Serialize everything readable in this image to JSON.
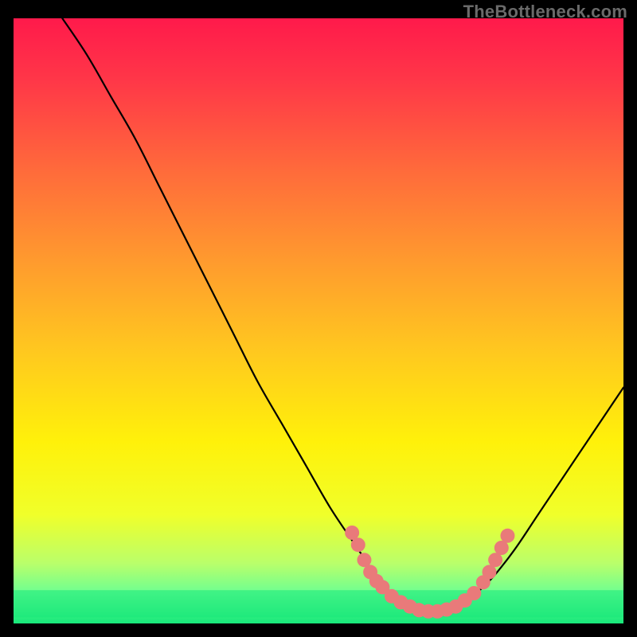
{
  "watermark": "TheBottleneck.com",
  "chart_data": {
    "type": "line",
    "title": "",
    "xlabel": "",
    "ylabel": "",
    "xlim": [
      0,
      100
    ],
    "ylim": [
      0,
      100
    ],
    "grid": false,
    "background_gradient": {
      "stops": [
        {
          "offset": 0.0,
          "color": "#ff1a4b"
        },
        {
          "offset": 0.1,
          "color": "#ff3648"
        },
        {
          "offset": 0.25,
          "color": "#ff6a3b"
        },
        {
          "offset": 0.4,
          "color": "#ff9a2e"
        },
        {
          "offset": 0.55,
          "color": "#ffc81f"
        },
        {
          "offset": 0.7,
          "color": "#fff10a"
        },
        {
          "offset": 0.82,
          "color": "#f0ff2a"
        },
        {
          "offset": 0.9,
          "color": "#baff6a"
        },
        {
          "offset": 0.95,
          "color": "#6dff92"
        },
        {
          "offset": 1.0,
          "color": "#17e87a"
        }
      ]
    },
    "series": [
      {
        "name": "curve",
        "color": "#000000",
        "x": [
          8,
          12,
          16,
          20,
          24,
          28,
          32,
          36,
          40,
          44,
          48,
          52,
          56,
          58,
          60,
          62,
          64,
          66,
          68,
          70,
          72,
          74,
          78,
          82,
          86,
          90,
          94,
          98,
          100
        ],
        "y": [
          100,
          94,
          87,
          80,
          72,
          64,
          56,
          48,
          40,
          33,
          26,
          19,
          13,
          10,
          7,
          5,
          3.5,
          2.5,
          2,
          2,
          2.5,
          3.5,
          7,
          12,
          18,
          24,
          30,
          36,
          39
        ]
      }
    ],
    "highlight_scatter": {
      "name": "highlight-dots",
      "color": "#e97a7a",
      "radius": 9,
      "points": [
        {
          "x": 55.5,
          "y": 15.0
        },
        {
          "x": 56.5,
          "y": 13.0
        },
        {
          "x": 57.5,
          "y": 10.5
        },
        {
          "x": 58.5,
          "y": 8.5
        },
        {
          "x": 59.5,
          "y": 7.0
        },
        {
          "x": 60.5,
          "y": 6.0
        },
        {
          "x": 62.0,
          "y": 4.5
        },
        {
          "x": 63.5,
          "y": 3.5
        },
        {
          "x": 65.0,
          "y": 2.8
        },
        {
          "x": 66.5,
          "y": 2.2
        },
        {
          "x": 68.0,
          "y": 2.0
        },
        {
          "x": 69.5,
          "y": 2.0
        },
        {
          "x": 71.0,
          "y": 2.3
        },
        {
          "x": 72.5,
          "y": 2.8
        },
        {
          "x": 74.0,
          "y": 3.8
        },
        {
          "x": 75.5,
          "y": 5.0
        },
        {
          "x": 77.0,
          "y": 6.8
        },
        {
          "x": 78.0,
          "y": 8.5
        },
        {
          "x": 79.0,
          "y": 10.5
        },
        {
          "x": 80.0,
          "y": 12.5
        },
        {
          "x": 81.0,
          "y": 14.5
        }
      ]
    }
  }
}
